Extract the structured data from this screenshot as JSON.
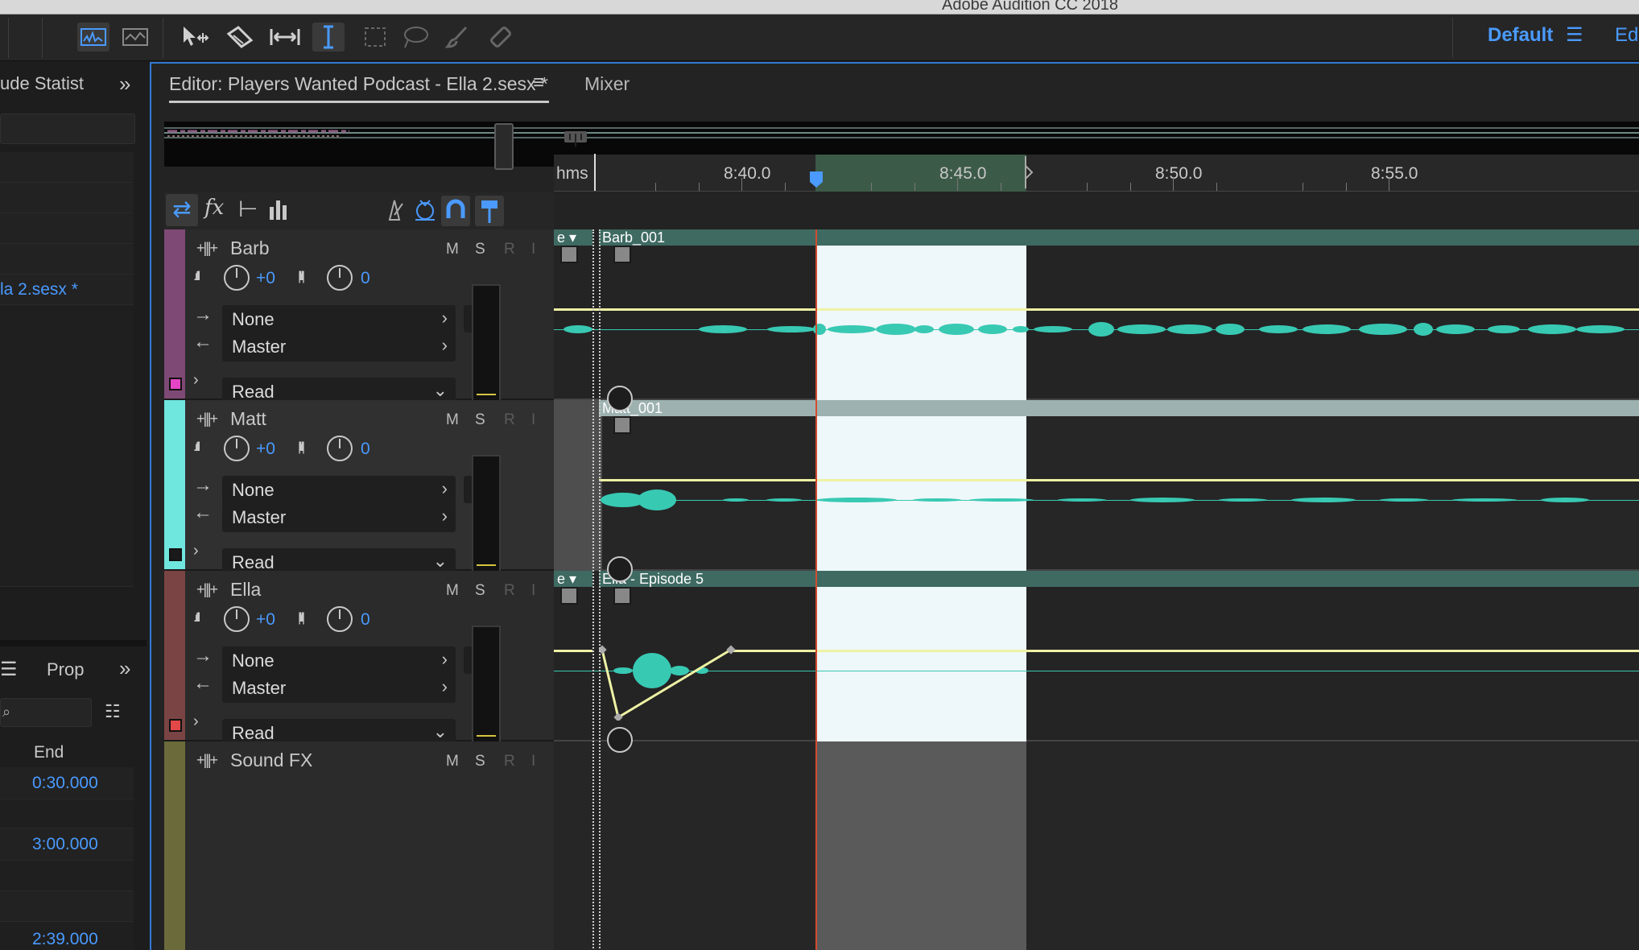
{
  "app": {
    "title": "Adobe Audition CC 2018"
  },
  "toolbar": {
    "workspace_label": "Default",
    "edit_label": "Edi"
  },
  "left_panel": {
    "top_tab": "ude Statist",
    "file_link": "la 2.sesx *",
    "bottom_tab": "Prop",
    "col_end": "End",
    "end_values": [
      "0:30.000",
      "3:00.000",
      "2:39.000"
    ]
  },
  "editor": {
    "tab_label": "Editor: Players Wanted Podcast - Ella 2.sesx *",
    "mixer_label": "Mixer",
    "ruler": {
      "unit": "hms",
      "labels": [
        "8:40.0",
        "8:45.0",
        "8:50.0",
        "8:55.0"
      ]
    },
    "tracks": [
      {
        "name": "Barb",
        "color": "#7e4a75",
        "vol": "+0",
        "pan": "0",
        "input": "None",
        "output": "Master",
        "automation": "Read",
        "clip": "Barb_001",
        "clip_prefix": "e"
      },
      {
        "name": "Matt",
        "color": "#6fe6de",
        "vol": "+0",
        "pan": "0",
        "input": "None",
        "output": "Master",
        "automation": "Read",
        "clip": "Matt_001"
      },
      {
        "name": "Ella",
        "color": "#7b4444",
        "vol": "+0",
        "pan": "0",
        "input": "None",
        "output": "Master",
        "automation": "Read",
        "clip": "Ella - Episode 5",
        "clip_prefix": "e"
      },
      {
        "name": "Sound FX",
        "color": "#6b6a3a"
      }
    ],
    "buttons": {
      "mute": "M",
      "solo": "S",
      "record": "R",
      "input_monitor": "I"
    }
  }
}
